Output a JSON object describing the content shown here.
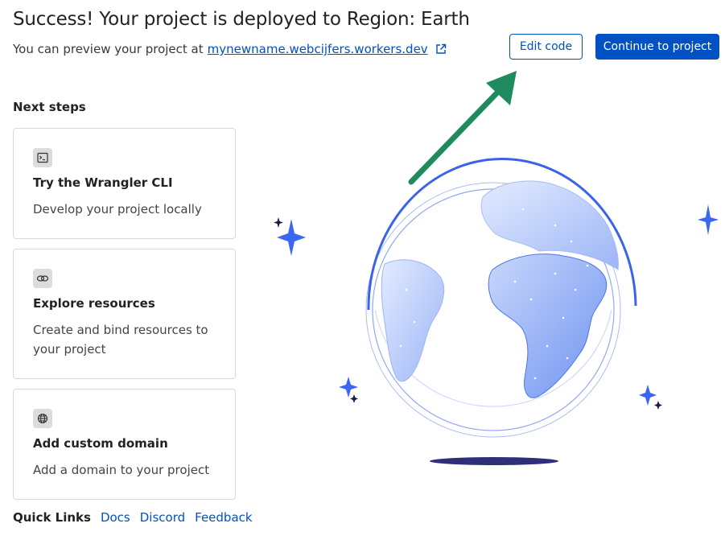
{
  "header": {
    "title": "Success! Your project is deployed to Region: Earth",
    "preview_prefix": "You can preview your project at",
    "preview_url": "mynewname.webcijfers.workers.dev",
    "external_icon": "external-link-icon"
  },
  "actions": {
    "edit_label": "Edit code",
    "continue_label": "Continue to project"
  },
  "next_steps": {
    "heading": "Next steps",
    "cards": [
      {
        "icon": "terminal-icon",
        "title": "Try the Wrangler CLI",
        "description": "Develop your project locally"
      },
      {
        "icon": "link-icon",
        "title": "Explore resources",
        "description": "Create and bind resources to your project"
      },
      {
        "icon": "globe-icon",
        "title": "Add custom domain",
        "description": "Add a domain to your project"
      }
    ]
  },
  "quick_links": {
    "label": "Quick Links",
    "links": [
      "Docs",
      "Discord",
      "Feedback"
    ]
  },
  "colors": {
    "accent": "#0051c3",
    "arrow": "#1e8a5e",
    "globe": "#6b8ff0",
    "sparkle": "#3b66f0"
  }
}
